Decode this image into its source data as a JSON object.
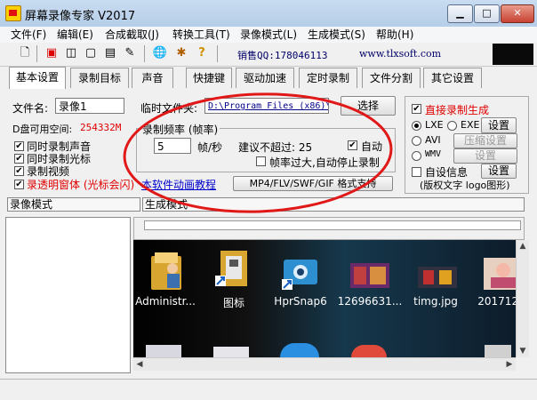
{
  "window": {
    "title": "屏幕录像专家 V2017"
  },
  "menu": [
    "文件(F)",
    "编辑(E)",
    "合成截取(J)",
    "转换工具(T)",
    "录像模式(L)",
    "生成模式(S)",
    "帮助(H)"
  ],
  "toolbar": {
    "qq": "销售QQ:178046113",
    "url": "www.tlxsoft.com"
  },
  "tabs": [
    "基本设置",
    "录制目标",
    "声音",
    "快捷键",
    "驱动加速",
    "定时录制",
    "文件分割",
    "其它设置"
  ],
  "basic": {
    "filename_label": "文件名:",
    "filename_value": "录像1",
    "tempfolder_label": "临时文件夹:",
    "tempfolder_value": "D:\\Program Files (x86)\\",
    "select_button": "选择",
    "disk_label": "D盘可用空间:",
    "disk_value": "254332M",
    "cb_sound": "同时录制声音",
    "cb_cursor": "同时录制光标",
    "cb_video": "录制视频",
    "cb_transparent": "录透明窗体 (光标会闪)",
    "tutorial_link": "本软件动画教程",
    "framerate_group": "录制频率 (帧率)",
    "framerate_value": "5",
    "framerate_unit": "帧/秒",
    "suggest_text": "建议不超过: 25",
    "auto_label": "自动",
    "stop_on_high": "帧率过大,自动停止录制",
    "format_button": "MP4/FLV/SWF/GIF 格式支持"
  },
  "right_panel": {
    "direct_gen": "直接录制生成",
    "lxe": "LXE",
    "exe": "EXE",
    "settings": "设置",
    "avi": "AVI",
    "compress_settings": "压缩设置",
    "wmv": "WMV",
    "wmv_settings": "设置",
    "custom_info": "自设信息",
    "custom_settings": "设置",
    "copyright_text": "(版权文字 logo图形)"
  },
  "panes": {
    "record_mode": "录像模式",
    "gen_mode": "生成模式"
  },
  "desktop_icons": [
    "Administr...",
    "图标",
    "HprSnap6",
    "12696631...",
    "timg.jpg",
    "2017121"
  ],
  "colors": {
    "accent_red": "#e00000",
    "link_blue": "#0000cc",
    "ellipse": "#e01818"
  }
}
